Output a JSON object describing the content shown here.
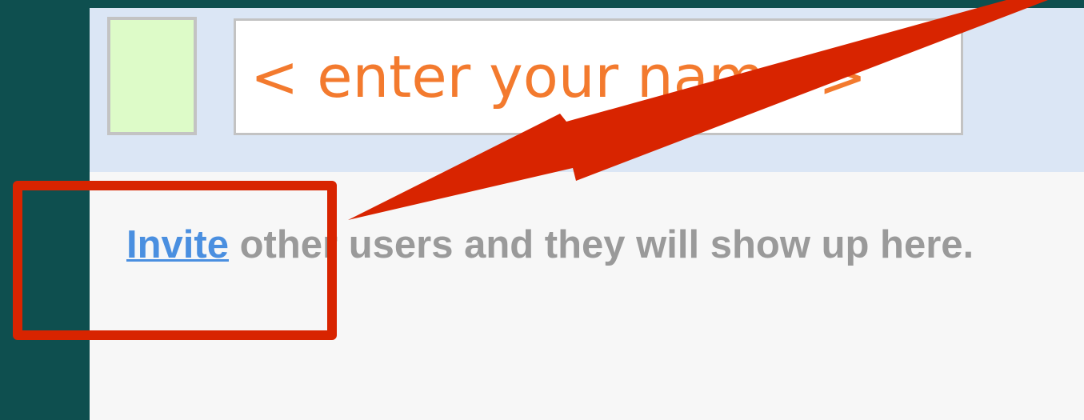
{
  "profile": {
    "name_placeholder": "< enter your name >",
    "avatar_color": "#ddfbc8"
  },
  "empty_state": {
    "invite_link": "Invite",
    "message": " other users and they will show up here."
  },
  "annotation": {
    "color": "#d82400"
  }
}
